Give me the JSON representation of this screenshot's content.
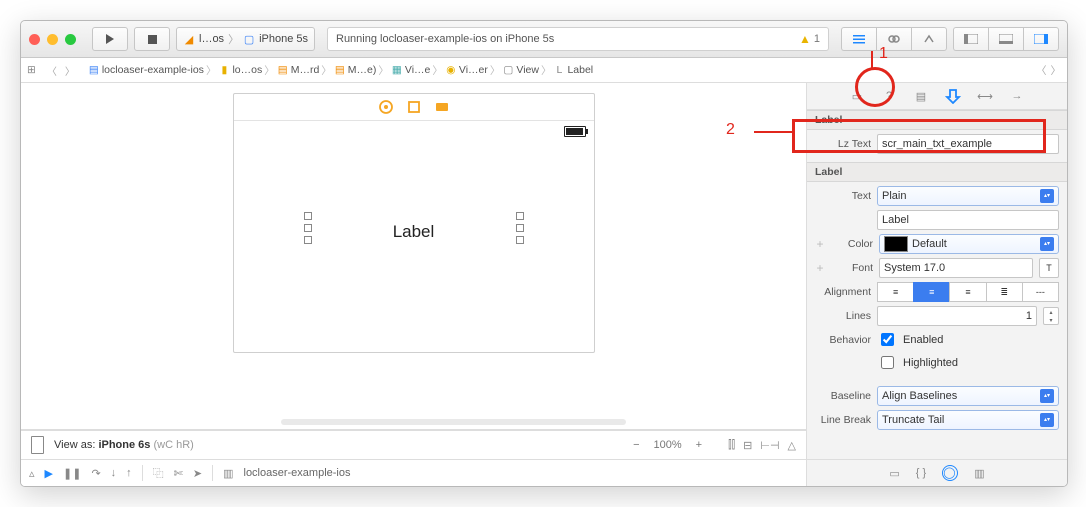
{
  "toolbar": {
    "scheme_target": "l…os",
    "scheme_device": "iPhone 5s",
    "status_text": "Running locloaser-example-ios on iPhone 5s",
    "warning_count": "1"
  },
  "breadcrumb": {
    "items": [
      {
        "label": "locloaser-example-ios",
        "icon": "project"
      },
      {
        "label": "lo…os",
        "icon": "folder"
      },
      {
        "label": "M…rd",
        "icon": "storyboard"
      },
      {
        "label": "M…e)",
        "icon": "storyboard"
      },
      {
        "label": "Vi…e",
        "icon": "scene"
      },
      {
        "label": "Vi…er",
        "icon": "controller"
      },
      {
        "label": "View",
        "icon": "view"
      },
      {
        "label": "Label",
        "icon": "label"
      }
    ]
  },
  "canvas": {
    "placed_label_text": "Label"
  },
  "viewas": {
    "prefix": "View as:",
    "device": "iPhone 6s",
    "size_class": "(wC hR)",
    "zoom": "100%"
  },
  "debug": {
    "target": "locloaser-example-ios"
  },
  "inspector": {
    "section1_title": "Label",
    "lz_text_label": "Lz Text",
    "lz_text_value": "scr_main_txt_example",
    "section2_title": "Label",
    "text_label": "Text",
    "text_mode": "Plain",
    "text_value": "Label",
    "color_label": "Color",
    "color_value": "Default",
    "font_label": "Font",
    "font_value": "System 17.0",
    "alignment_label": "Alignment",
    "lines_label": "Lines",
    "lines_value": "1",
    "behavior_label": "Behavior",
    "behavior_enabled": "Enabled",
    "behavior_highlighted": "Highlighted",
    "baseline_label": "Baseline",
    "baseline_value": "Align Baselines",
    "linebreak_label": "Line Break",
    "linebreak_value": "Truncate Tail"
  },
  "annotations": {
    "num1": "1",
    "num2": "2"
  }
}
